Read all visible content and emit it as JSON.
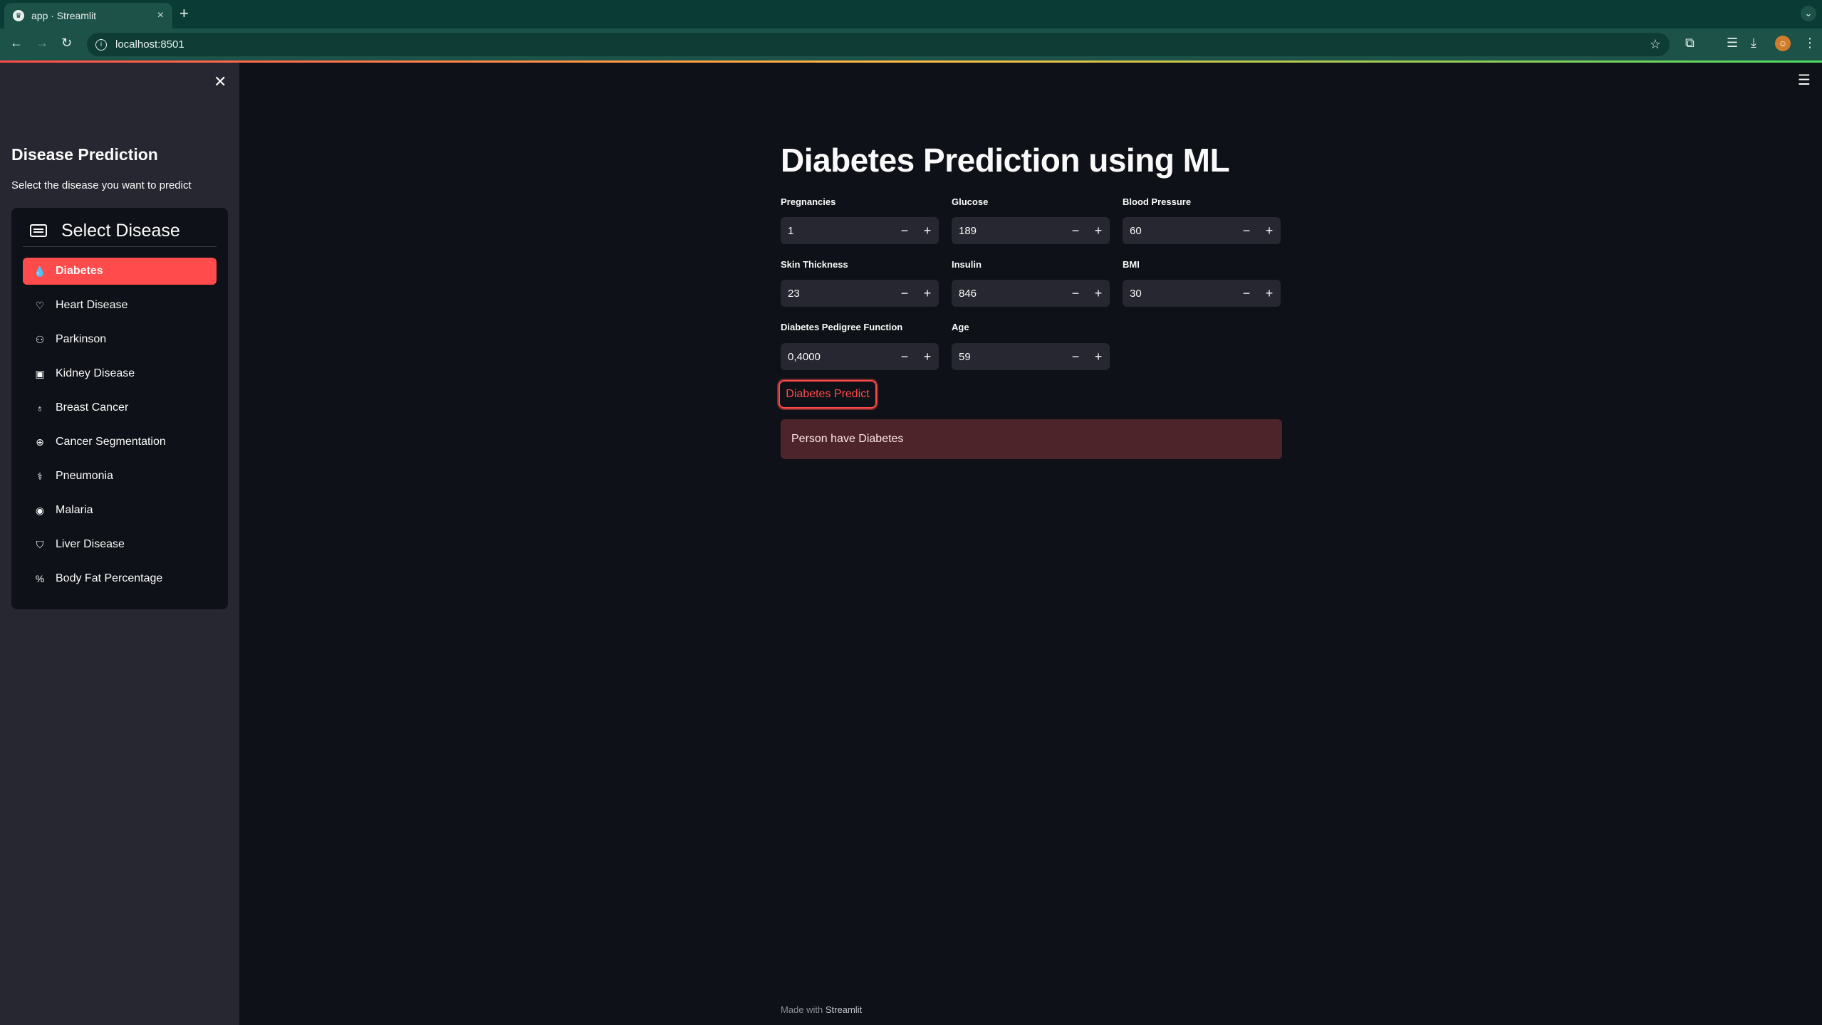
{
  "browser": {
    "tab_title": "app · Streamlit",
    "tab_close": "×",
    "new_tab": "+",
    "url": "localhost:8501"
  },
  "sidebar": {
    "title": "Disease Prediction",
    "subtitle": "Select the disease you want to predict",
    "menu_title": "Select Disease",
    "items": [
      {
        "label": "Diabetes",
        "icon": "droplet-icon",
        "glyph": "💧",
        "active": true
      },
      {
        "label": "Heart Disease",
        "icon": "heart-icon",
        "glyph": "♡"
      },
      {
        "label": "Parkinson",
        "icon": "person-icon",
        "glyph": "👤"
      },
      {
        "label": "Kidney Disease",
        "icon": "clipboard-icon",
        "glyph": "📋"
      },
      {
        "label": "Breast Cancer",
        "icon": "award-icon",
        "glyph": "🎗"
      },
      {
        "label": "Cancer Segmentation",
        "icon": "zoom-icon",
        "glyph": "🔍"
      },
      {
        "label": "Pneumonia",
        "icon": "lungs-icon",
        "glyph": "🫁"
      },
      {
        "label": "Malaria",
        "icon": "globe-icon",
        "glyph": "🌐"
      },
      {
        "label": "Liver Disease",
        "icon": "bottle-icon",
        "glyph": "🧴"
      },
      {
        "label": "Body Fat Percentage",
        "icon": "percent-icon",
        "glyph": "%"
      }
    ]
  },
  "main": {
    "title": "Diabetes Prediction using ML",
    "fields": {
      "pregnancies": {
        "label": "Pregnancies",
        "value": "1"
      },
      "glucose": {
        "label": "Glucose",
        "value": "189"
      },
      "blood_pressure": {
        "label": "Blood Pressure",
        "value": "60"
      },
      "skin_thickness": {
        "label": "Skin Thickness",
        "value": "23"
      },
      "insulin": {
        "label": "Insulin",
        "value": "846"
      },
      "bmi": {
        "label": "BMI",
        "value": "30"
      },
      "dpf": {
        "label": "Diabetes Pedigree Function",
        "value": "0,4000"
      },
      "age": {
        "label": "Age",
        "value": "59"
      }
    },
    "stepper_minus": "−",
    "stepper_plus": "+",
    "predict_button": "Diabetes Predict",
    "result": "Person have Diabetes"
  },
  "footer": {
    "prefix": "Made with",
    "brand": "Streamlit"
  },
  "colors": {
    "primary": "#ff4b4b",
    "background": "#0e1117",
    "sidebar_bg": "#262730",
    "error_bg": "#4e242b"
  }
}
